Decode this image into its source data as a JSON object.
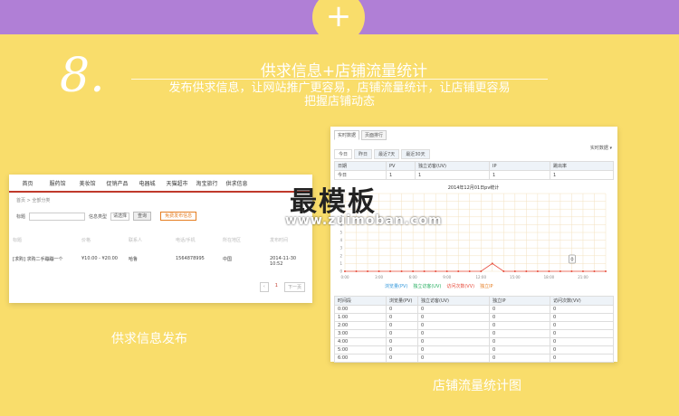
{
  "header": {
    "plus": "+",
    "step": "8.",
    "title": "供求信息+店铺流量统计",
    "subtitle_line1": "发布供求信息，让网站推广更容易，店铺流量统计，让店铺更容易",
    "subtitle_line2": "把握店铺动态"
  },
  "left_panel": {
    "nav": [
      "首页",
      "服药馆",
      "美妆馆",
      "促销产品",
      "电器城",
      "天猫超市",
      "淘宝旅行",
      "供求信息"
    ],
    "breadcrumb": "首页 > 全部分类",
    "search": {
      "label": "标题",
      "type_label": "信息类型",
      "type_value": "请选择",
      "search_button": "查询",
      "publish_button": "免费发布信息"
    },
    "columns": [
      "标题",
      "价格",
      "联系人",
      "电话/手机",
      "所在地区",
      "发布时间"
    ],
    "row": {
      "title": "[求购] 求购二手蹦蹦一个",
      "price": "¥10.00 - ¥20.00",
      "contact": "哈鲁",
      "phone": "1564878995",
      "region": "中国",
      "time": "2014-11-30 10:52"
    },
    "pager": {
      "prev": "‹",
      "page": "1",
      "next": "下一页"
    },
    "caption": "供求信息发布"
  },
  "right_panel": {
    "top_tabs": [
      "实时数据",
      "页面排行"
    ],
    "select": "实时数据 ▾",
    "day_tabs": [
      "今日",
      "昨日",
      "最近7天",
      "最近30天"
    ],
    "summary_header": [
      "日期",
      "PV",
      "独立访客(UV)",
      "IP",
      "跳出率"
    ],
    "summary_row": [
      "今日",
      "1",
      "1",
      "1",
      "1"
    ],
    "chart_title": "2014年12月01日pv统计",
    "legend": [
      "浏览量(PV)",
      "独立访客(UV)",
      "访问次数(VV)",
      "独立IP"
    ],
    "table_header": [
      "时间段",
      "浏览量(PV)",
      "独立访客(UV)",
      "独立IP",
      "访问次数(VV)"
    ],
    "table_rows": [
      [
        "0:00",
        "0",
        "0",
        "0",
        "0"
      ],
      [
        "1:00",
        "0",
        "0",
        "0",
        "0"
      ],
      [
        "2:00",
        "0",
        "0",
        "0",
        "0"
      ],
      [
        "3:00",
        "0",
        "0",
        "0",
        "0"
      ],
      [
        "4:00",
        "0",
        "0",
        "0",
        "0"
      ],
      [
        "5:00",
        "0",
        "0",
        "0",
        "0"
      ],
      [
        "6:00",
        "0",
        "0",
        "0",
        "0"
      ]
    ],
    "caption": "店铺流量统计图"
  },
  "watermark": {
    "cn": "最模板",
    "url": "www.zuimoban.com"
  },
  "chart_data": {
    "type": "line",
    "title": "2014年12月01日pv统计",
    "x": [
      "0:00",
      "3:00",
      "6:00",
      "9:00",
      "12:00",
      "15:00",
      "18:00",
      "21:00"
    ],
    "ylim": [
      0,
      10
    ],
    "series": [
      {
        "name": "浏览量(PV)",
        "color": "#e74c3c",
        "values": [
          0,
          0,
          0,
          0,
          0,
          0,
          0,
          0,
          0,
          0,
          0,
          0,
          0,
          1,
          0,
          0,
          0,
          0,
          0,
          0,
          0,
          0,
          0,
          0
        ]
      }
    ],
    "tooltip_value": "0"
  },
  "colors": {
    "bg": "#f9dd6b",
    "band": "#b07fd6",
    "accent": "#c0392b"
  }
}
